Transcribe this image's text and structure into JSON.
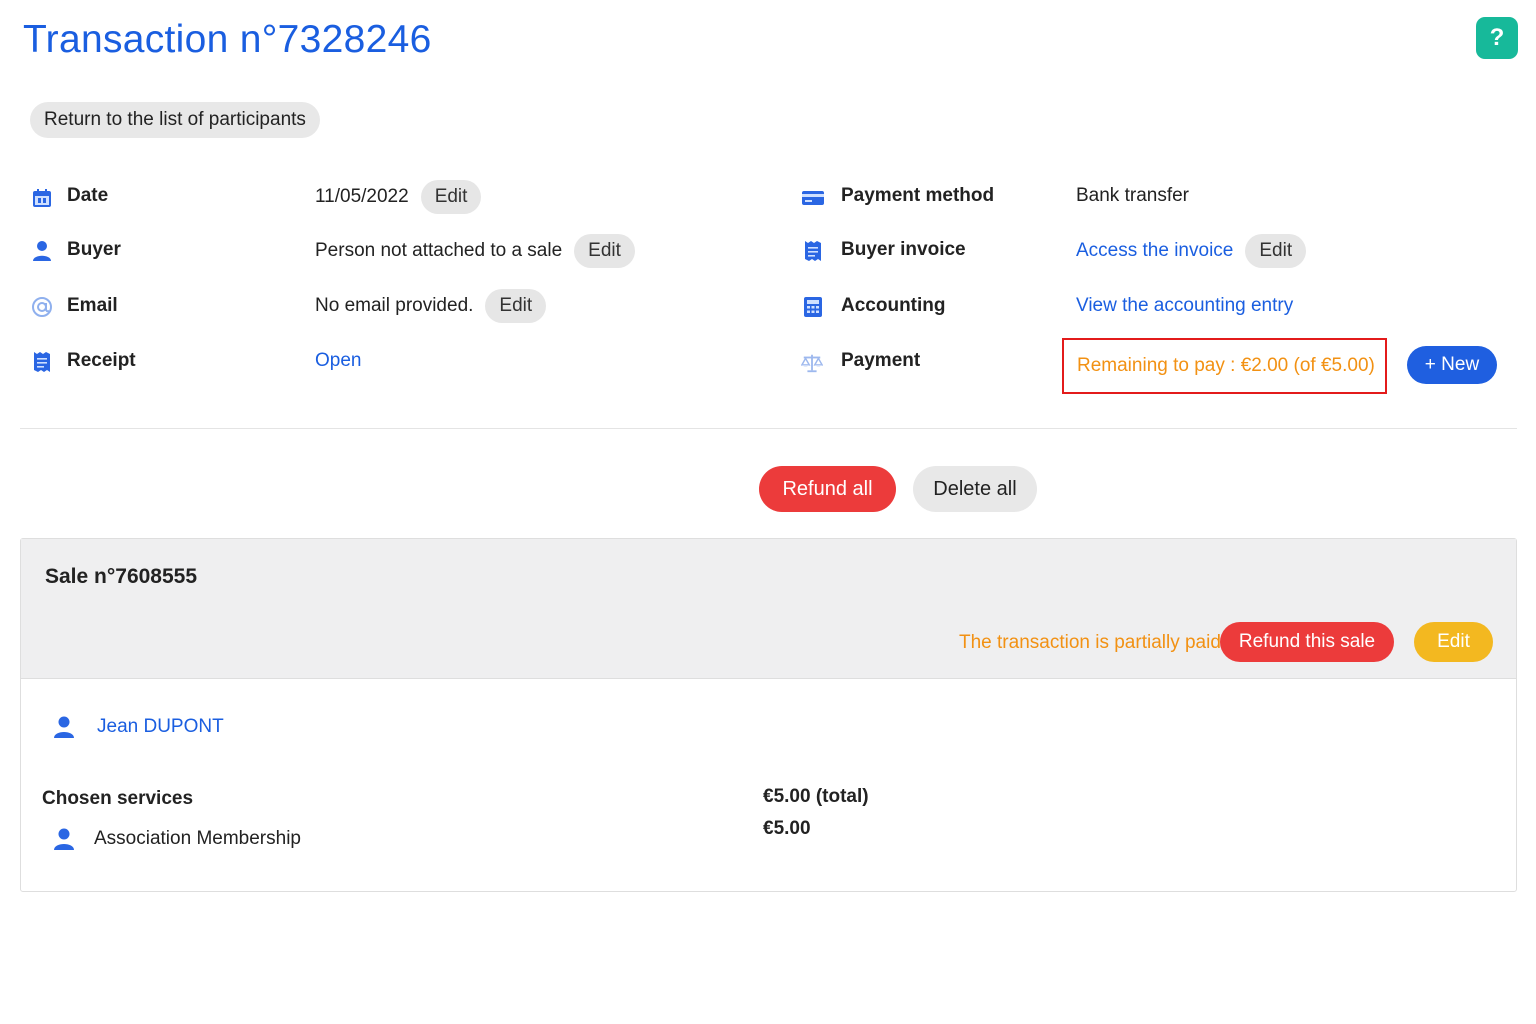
{
  "header": {
    "title": "Transaction n°7328246",
    "help_label": "?",
    "back_label": "Return to the list of participants"
  },
  "details_left": {
    "date": {
      "label": "Date",
      "value": "11/05/2022",
      "edit": "Edit"
    },
    "buyer": {
      "label": "Buyer",
      "value": "Person not attached to a sale",
      "edit": "Edit"
    },
    "email": {
      "label": "Email",
      "value": "No email provided.",
      "edit": "Edit"
    },
    "receipt": {
      "label": "Receipt",
      "value": "Open"
    }
  },
  "details_right": {
    "payment_method": {
      "label": "Payment method",
      "value": "Bank transfer"
    },
    "buyer_invoice": {
      "label": "Buyer invoice",
      "value": "Access the invoice",
      "edit": "Edit"
    },
    "accounting": {
      "label": "Accounting",
      "value": "View the accounting entry"
    },
    "payment": {
      "label": "Payment",
      "value": "Remaining to pay : €2.00 (of €5.00)",
      "new": "+ New"
    }
  },
  "actions": {
    "refund_all": "Refund all",
    "delete_all": "Delete all"
  },
  "sale": {
    "title": "Sale n°7608555",
    "status": "The transaction is partially paid.",
    "refund_label": "Refund this sale",
    "edit_label": "Edit",
    "participant": "Jean DUPONT",
    "chosen_services_label": "Chosen services",
    "total": "€5.00 (total)",
    "services": [
      {
        "name": "Association Membership",
        "price": "€5.00"
      }
    ]
  },
  "colors": {
    "primary_blue": "#1a5ee0",
    "danger_red": "#ec3b3b",
    "warning_orange": "#f29113",
    "edit_yellow": "#f3b820",
    "help_teal": "#17b99a",
    "highlight_border": "#e31b1b"
  }
}
